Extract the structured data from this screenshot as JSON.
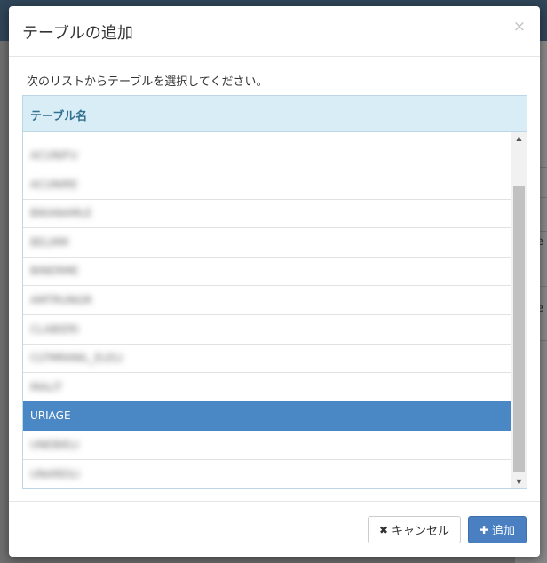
{
  "modal": {
    "title": "テーブルの追加",
    "close_icon": "close-icon",
    "instruction": "次のリストからテーブルを選択してください。"
  },
  "table": {
    "header": "テーブル名",
    "rows": [
      {
        "label": "ACUNIFU"
      },
      {
        "label": "ACUNIRE"
      },
      {
        "label": "BIKANAMLE"
      },
      {
        "label": "BELMM"
      },
      {
        "label": "BINERME"
      },
      {
        "label": "AMTRUNGR"
      },
      {
        "label": "CLABIERI"
      },
      {
        "label": "CLTMRANIL_ELELI"
      },
      {
        "label": "MALIT"
      },
      {
        "label": "URIAGE",
        "selected": true
      },
      {
        "label": "UNEBIELI"
      },
      {
        "label": "UNAREILI"
      }
    ]
  },
  "footer": {
    "cancel_label": "キャンセル",
    "cancel_icon": "times-icon",
    "add_label": "追加",
    "add_icon": "plus-icon"
  },
  "background": {
    "partial_text_1": "e",
    "partial_text_2": "e"
  },
  "colors": {
    "header_bg": "#d9edf7",
    "selected_row": "#4a87c5",
    "primary_button": "#4a7fc1"
  }
}
